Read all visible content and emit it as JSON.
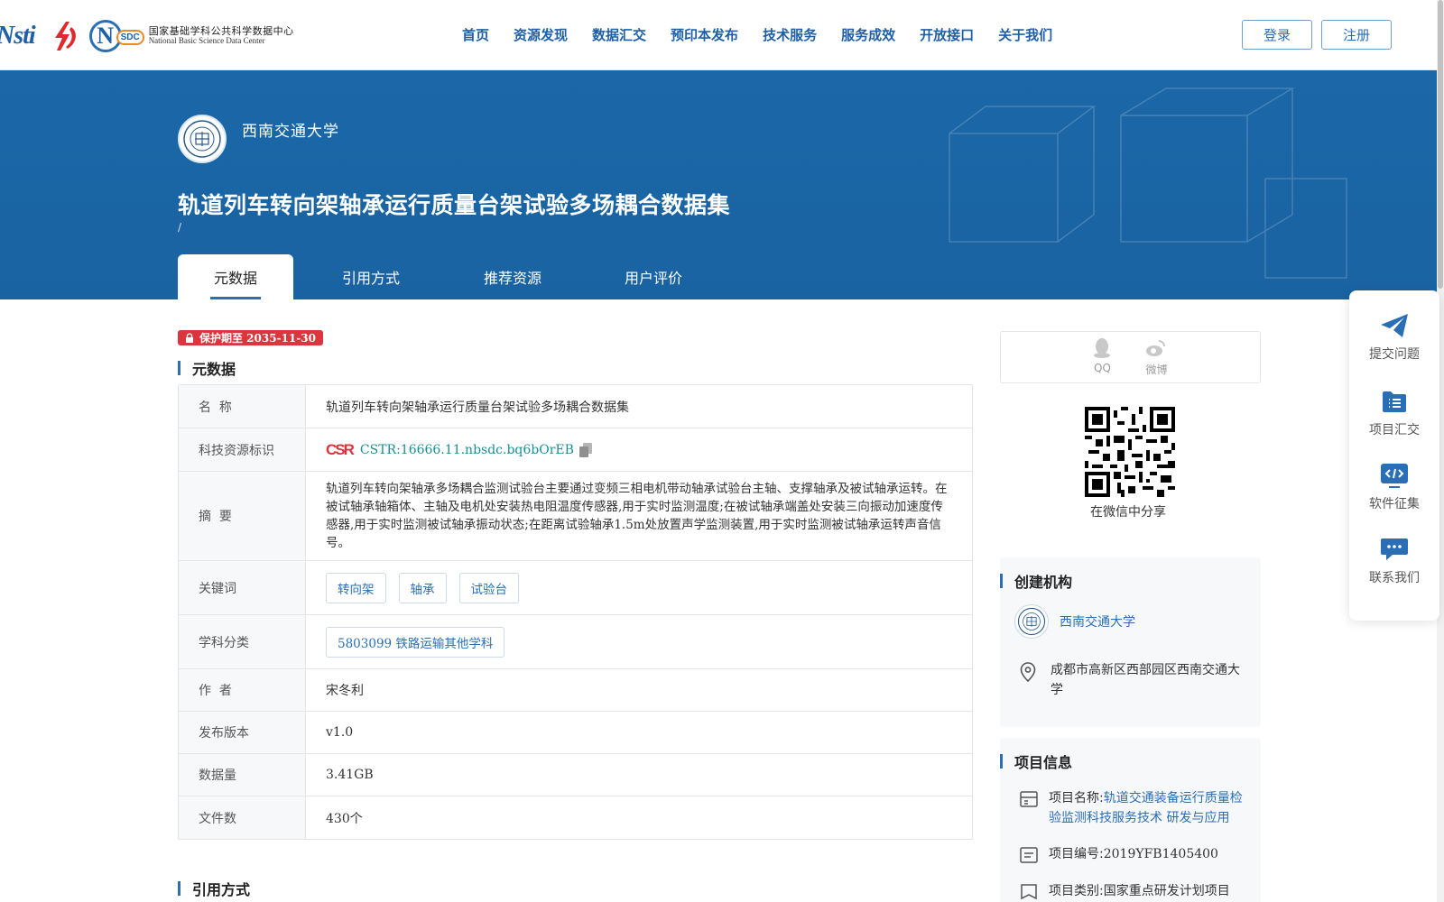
{
  "header": {
    "logos": {
      "nsti": "Nsti",
      "nsdc_letter": "N",
      "nsdc_tag": "SDC",
      "nsdc_cn": "国家基础学科公共科学数据中心",
      "nsdc_en": "National Basic Science Data Center"
    },
    "nav": [
      "首页",
      "资源发现",
      "数据汇交",
      "预印本发布",
      "技术服务",
      "服务成效",
      "开放接口",
      "关于我们"
    ],
    "login": "登录",
    "register": "注册"
  },
  "banner": {
    "org_name": "西南交通大学",
    "title": "轨道列车转向架轴承运行质量台架试验多场耦合数据集",
    "subtitle": "/",
    "tabs": [
      "元数据",
      "引用方式",
      "推荐资源",
      "用户评价"
    ]
  },
  "badge": {
    "text": "保护期至 2035-11-30",
    "icon": "lock-icon"
  },
  "metadata": {
    "heading": "元数据",
    "rows": {
      "name": {
        "k": "名  称",
        "v": "轨道列车转向架轴承运行质量台架试验多场耦合数据集"
      },
      "cstr": {
        "k": "科技资源标识",
        "logo": "CSR",
        "v": "CSTR:16666.11.nbsdc.bq6bOrEB"
      },
      "abstract": {
        "k": "摘  要",
        "v": "轨道列车转向架轴承多场耦合监测试验台主要通过变频三相电机带动轴承试验台主轴、支撑轴承及被试轴承运转。在被试轴承轴箱体、主轴及电机处安装热电阻温度传感器,用于实时监测温度;在被试轴承端盖处安装三向振动加速度传感器,用于实时监测被试轴承振动状态;在距离试验轴承1.5m处放置声学监测装置,用于实时监测被试轴承运转声音信号。"
      },
      "keywords": {
        "k": "关键词",
        "tags": [
          "转向架",
          "轴承",
          "试验台"
        ]
      },
      "subject": {
        "k": "学科分类",
        "tag": "5803099 铁路运输其他学科"
      },
      "author": {
        "k": "作  者",
        "v": "宋冬利"
      },
      "version": {
        "k": "发布版本",
        "v": "v1.0"
      },
      "size": {
        "k": "数据量",
        "v": "3.41GB"
      },
      "files": {
        "k": "文件数",
        "v": "430个"
      }
    }
  },
  "citation_heading": "引用方式",
  "share": {
    "qq": "QQ",
    "weibo": "微博",
    "wechat": "在微信中分享"
  },
  "creator": {
    "heading": "创建机构",
    "org": "西南交通大学",
    "address": "成都市高新区西部园区西南交通大学"
  },
  "project": {
    "heading": "项目信息",
    "name_label": "项目名称:",
    "name_value": "轨道交通装备运行质量检验监测科技服务技术 研发与应用",
    "id_label": "项目编号:",
    "id_value": "2019YFB1405400",
    "type_label": "项目类别:",
    "type_value": "国家重点研发计划项目"
  },
  "float_panel": [
    "提交问题",
    "项目汇交",
    "软件征集",
    "联系我们"
  ],
  "colors": {
    "brand": "#1f5fa8",
    "banner": "#1b67a7",
    "badge": "#d9363e",
    "cstr_link": "#1b8f8f"
  }
}
